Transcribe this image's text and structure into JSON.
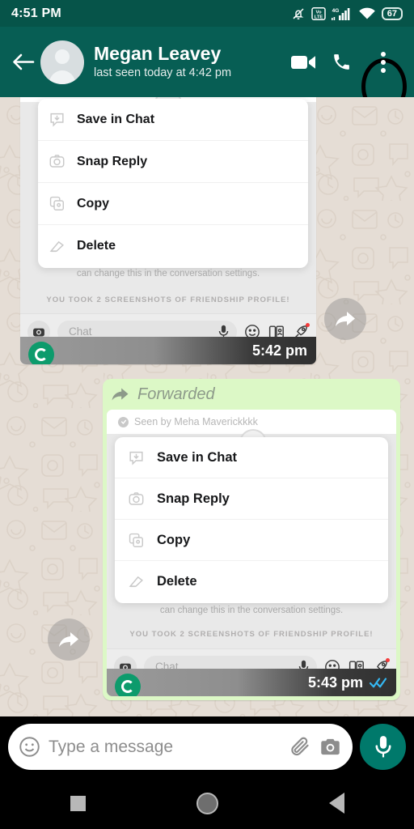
{
  "status_bar": {
    "time": "4:51 PM",
    "battery_level": "67",
    "icons": [
      "bell-muted-icon",
      "volte-icon",
      "signal-4g-icon",
      "wifi-icon",
      "battery-icon"
    ]
  },
  "header": {
    "back_icon": "back-arrow-icon",
    "contact_name": "Megan Leavey",
    "contact_status": "last seen today at 4:42 pm",
    "video_call_icon": "video-call-icon",
    "voice_call_icon": "phone-call-icon",
    "overflow_icon": "three-dots-menu-icon",
    "accent_color": "#075E54",
    "status_bar_color": "#065449"
  },
  "messages": [
    {
      "direction": "incoming",
      "bubble_color": "#ffffff",
      "time": "5:42 pm",
      "forwarded": false,
      "forwarded_label": "",
      "seen_by": "",
      "menu_items": [
        {
          "label": "Save in Chat",
          "icon": "save-in-chat-icon"
        },
        {
          "label": "Snap Reply",
          "icon": "camera-icon"
        },
        {
          "label": "Copy",
          "icon": "copy-icon"
        },
        {
          "label": "Delete",
          "icon": "eraser-icon"
        }
      ],
      "conversation_note": "can change this in the conversation settings.",
      "screenshot_note": "YOU TOOK 2 SCREENSHOTS OF FRIENDSHIP PROFILE!",
      "chat_placeholder": "Chat",
      "chat_icons": [
        "camera-icon",
        "mic-icon",
        "smiley-icon",
        "cards-icon",
        "rocket-icon"
      ],
      "read_receipt": ""
    },
    {
      "direction": "outgoing",
      "bubble_color": "#DCF8C6",
      "time": "5:43 pm",
      "forwarded": true,
      "forwarded_label": "Forwarded",
      "seen_by": "Seen by Meha Maverickkkk",
      "menu_items": [
        {
          "label": "Save in Chat",
          "icon": "save-in-chat-icon"
        },
        {
          "label": "Snap Reply",
          "icon": "camera-icon"
        },
        {
          "label": "Copy",
          "icon": "copy-icon"
        },
        {
          "label": "Delete",
          "icon": "eraser-icon"
        }
      ],
      "conversation_note": "can change this in the conversation settings.",
      "screenshot_note": "YOU TOOK 2 SCREENSHOTS OF FRIENDSHIP PROFILE!",
      "chat_placeholder": "Chat",
      "chat_icons": [
        "camera-icon",
        "mic-icon",
        "smiley-icon",
        "cards-icon",
        "rocket-icon"
      ],
      "read_receipt": "double-blue-check-icon"
    }
  ],
  "forward_buttons": [
    {
      "icon": "forward-arrow-icon"
    },
    {
      "icon": "forward-arrow-icon"
    }
  ],
  "input_bar": {
    "emoji_icon": "emoji-smiley-icon",
    "placeholder": "Type a message",
    "attach_icon": "paperclip-icon",
    "camera_icon": "camera-icon",
    "mic_icon": "mic-icon",
    "mic_button_color": "#00796B"
  },
  "nav_bar": {
    "recents_icon": "square-recents-icon",
    "home_icon": "circle-home-icon",
    "back_icon": "triangle-back-icon"
  }
}
